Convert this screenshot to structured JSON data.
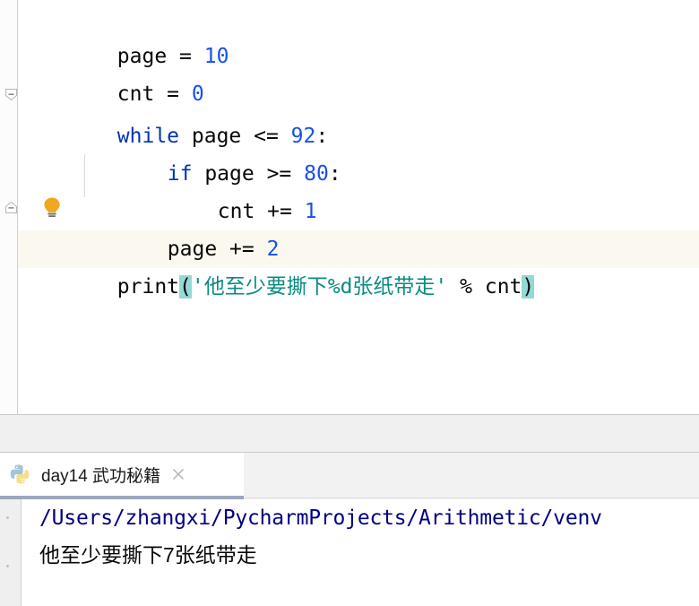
{
  "editor": {
    "lines": [
      {
        "indent": 0,
        "tokens": [
          {
            "t": "page ",
            "c": "plain"
          },
          {
            "t": "= ",
            "c": "op"
          },
          {
            "t": "10",
            "c": "num"
          }
        ]
      },
      {
        "indent": 0,
        "tokens": [
          {
            "t": "cnt ",
            "c": "plain"
          },
          {
            "t": "= ",
            "c": "op"
          },
          {
            "t": "0",
            "c": "num"
          }
        ]
      },
      {
        "indent": 0,
        "tokens": [
          {
            "t": "while",
            "c": "kw"
          },
          {
            "t": " page ",
            "c": "plain"
          },
          {
            "t": "<= ",
            "c": "op"
          },
          {
            "t": "92",
            "c": "num"
          },
          {
            "t": ":",
            "c": "op"
          }
        ]
      },
      {
        "indent": 1,
        "tokens": [
          {
            "t": "if",
            "c": "kw"
          },
          {
            "t": " page ",
            "c": "plain"
          },
          {
            "t": ">= ",
            "c": "op"
          },
          {
            "t": "80",
            "c": "num"
          },
          {
            "t": ":",
            "c": "op"
          }
        ]
      },
      {
        "indent": 2,
        "tokens": [
          {
            "t": "cnt ",
            "c": "plain"
          },
          {
            "t": "+= ",
            "c": "op"
          },
          {
            "t": "1",
            "c": "num"
          }
        ]
      },
      {
        "indent": 1,
        "tokens": [
          {
            "t": "page ",
            "c": "plain"
          },
          {
            "t": "+= ",
            "c": "op"
          },
          {
            "t": "2",
            "c": "num"
          }
        ]
      },
      {
        "indent": 0,
        "highlighted": true,
        "tokens": [
          {
            "t": "print",
            "c": "fn"
          },
          {
            "t": "(",
            "c": "paren-match"
          },
          {
            "t": "'他至少要撕下%d张纸带走'",
            "c": "str"
          },
          {
            "t": " ",
            "c": "plain"
          },
          {
            "t": "%",
            "c": "op"
          },
          {
            "t": " cnt",
            "c": "plain"
          },
          {
            "t": ")",
            "c": "paren-match"
          }
        ]
      }
    ],
    "fold_markers": [
      {
        "line": 2,
        "state": "expanded"
      },
      {
        "line": 5,
        "state": "expanded"
      }
    ],
    "intention_bulb": {
      "line": 5,
      "icon": "lightbulb-icon",
      "color": "#f0a81e"
    }
  },
  "run_window": {
    "tab": {
      "icon": "python-logo-icon",
      "label": "day14 武功秘籍",
      "close_icon": "close-icon",
      "active": true
    },
    "console": {
      "lines": [
        {
          "text": "/Users/zhangxi/PycharmProjects/Arithmetic/venv",
          "style": "path"
        },
        {
          "text": "他至少要撕下7张纸带走",
          "style": "out"
        }
      ]
    }
  },
  "colors": {
    "keyword": "#0033b3",
    "number": "#1750eb",
    "string": "#0a8b82",
    "paren_match_bg": "#93d9d4",
    "caret_line_bg": "#fbf8ef",
    "console_path": "#000080",
    "tab_underline": "#9aa7bd",
    "bulb": "#f0a81e"
  }
}
